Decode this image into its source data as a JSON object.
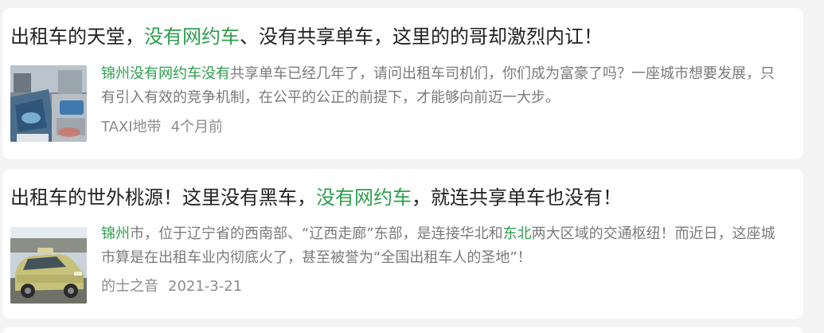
{
  "results": [
    {
      "title_before": "出租车的天堂，",
      "title_highlight": "没有网约车",
      "title_after": "、没有共享单车，这里的的哥却激烈内讧！",
      "summary_highlight": "锦州没有网约车没有",
      "summary_rest": "共享单车已经几年了，请问出租车司机们，你们成为富豪了吗？一座城市想要发展，只有引入有效的竞争机制，在公平的公正的前提下，才能够向前迈一大步。",
      "source": "TAXI地带",
      "time": "4个月前",
      "thumbnail_icon": "taxi-photo-thumbnail"
    },
    {
      "title_before": "出租车的世外桃源！这里没有黑车，",
      "title_highlight": "没有网约车",
      "title_after": "，就连共享单车也没有！",
      "summary_highlight_1": "锦州",
      "summary_text_1": "市，位于辽宁省的西南部、“辽西走廊”东部，是连接华北和",
      "summary_highlight_2": "东北",
      "summary_text_2": "两大区域的交通枢纽！而近日，这座城市算是在出租车业内彻底火了，甚至被誉为“全国出租车人的圣地”！",
      "source": "的士之音",
      "time": "2021-3-21",
      "thumbnail_icon": "taxi-car-photo-thumbnail"
    }
  ],
  "colors": {
    "highlight": "#2e9e4e",
    "title": "#222222",
    "summary": "#7a7a7a",
    "meta": "#8c8c8c",
    "background": "#f3f3f3",
    "card": "#ffffff"
  }
}
